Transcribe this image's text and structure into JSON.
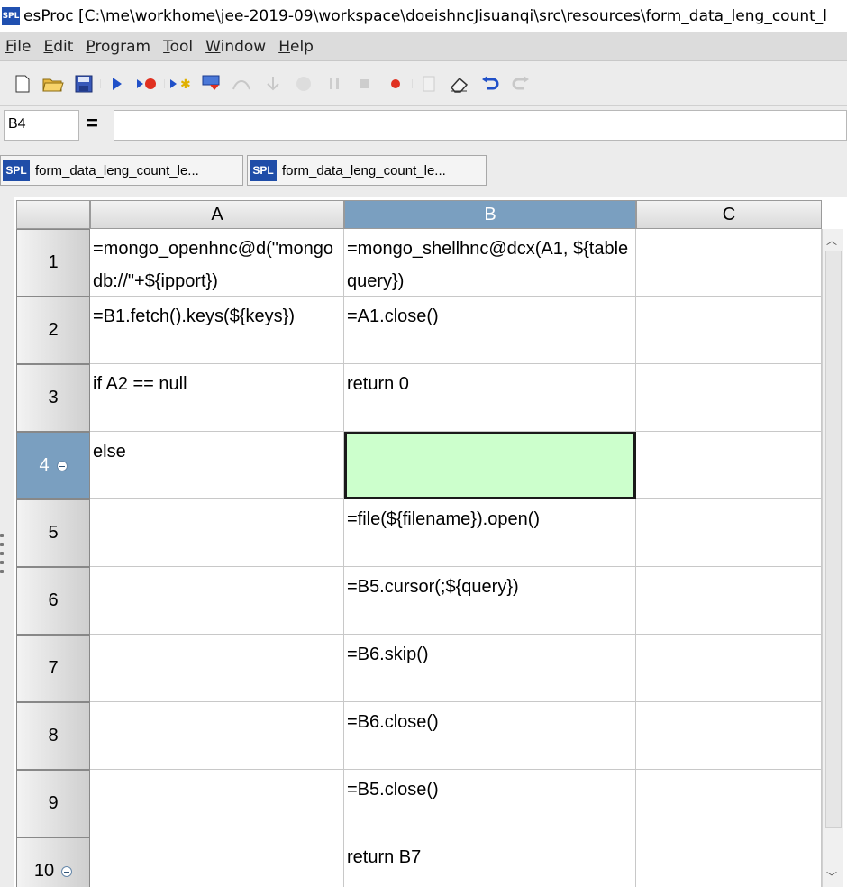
{
  "window": {
    "logo": "SPL",
    "title": "esProc  [C:\\me\\workhome\\jee-2019-09\\workspace\\doeishncJisuanqi\\src\\resources\\form_data_leng_count_l"
  },
  "menu": [
    {
      "mnemonic": "F",
      "rest": "ile"
    },
    {
      "mnemonic": "E",
      "rest": "dit"
    },
    {
      "mnemonic": "P",
      "rest": "rogram"
    },
    {
      "mnemonic": "T",
      "rest": "ool"
    },
    {
      "mnemonic": "W",
      "rest": "indow"
    },
    {
      "mnemonic": "H",
      "rest": "elp"
    }
  ],
  "toolbar": {
    "icons": [
      "new-file-icon",
      "open-folder-icon",
      "save-icon",
      "run-icon",
      "debug-icon",
      "step-icon",
      "run-to-cursor-icon",
      "step-over-icon",
      "step-into-icon",
      "stop-icon",
      "pause-icon",
      "stop-square-icon",
      "breakpoint-icon",
      "clear-icon",
      "eraser-icon",
      "undo-icon",
      "redo-icon"
    ]
  },
  "formula_bar": {
    "cell_ref": "B4",
    "equals": "=",
    "formula": ""
  },
  "tabs": [
    {
      "badge": "SPL",
      "label": "form_data_leng_count_le..."
    },
    {
      "badge": "SPL",
      "label": "form_data_leng_count_le..."
    }
  ],
  "grid": {
    "columns": [
      "A",
      "B",
      "C"
    ],
    "selected_column": "B",
    "selected_row": "4",
    "active_cell": "B4",
    "rows": [
      {
        "n": "1",
        "A": "=mongo_openhnc@d(\"mongodb://\"+${ipport})",
        "B": "=mongo_shellhnc@dcx(A1, ${tablequery})",
        "C": ""
      },
      {
        "n": "2",
        "A": "=B1.fetch().keys(${keys})",
        "B": "=A1.close()",
        "C": ""
      },
      {
        "n": "3",
        "A": "if A2 == null",
        "B": "return 0",
        "C": ""
      },
      {
        "n": "4",
        "A": "else",
        "B": "",
        "C": ""
      },
      {
        "n": "5",
        "A": "",
        "B": "=file(${filename}).open()",
        "C": ""
      },
      {
        "n": "6",
        "A": "",
        "B": "=B5.cursor(;${query})",
        "C": ""
      },
      {
        "n": "7",
        "A": "",
        "B": "=B6.skip()",
        "C": ""
      },
      {
        "n": "8",
        "A": "",
        "B": "=B6.close()",
        "C": ""
      },
      {
        "n": "9",
        "A": "",
        "B": "=B5.close()",
        "C": ""
      },
      {
        "n": "10",
        "A": "",
        "B": "return B7",
        "C": ""
      }
    ]
  }
}
